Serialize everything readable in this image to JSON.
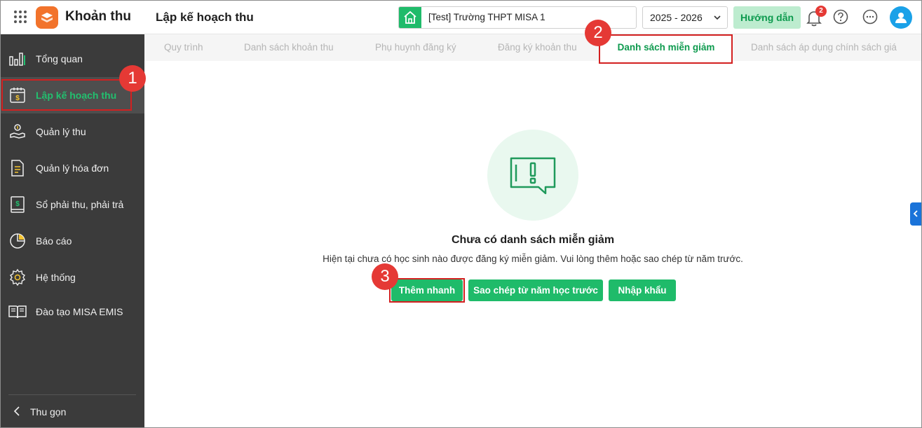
{
  "header": {
    "app_title": "Khoản thu",
    "page_title": "Lập kế hoạch thu",
    "school": "[Test] Trường THPT MISA 1",
    "year": "2025 - 2026",
    "guide_button": "Hướng dẫn",
    "notification_count": "2"
  },
  "sidebar": {
    "items": [
      {
        "label": "Tổng quan",
        "icon": "chart-bar-icon"
      },
      {
        "label": "Lập kế hoạch thu",
        "icon": "calendar-money-icon"
      },
      {
        "label": "Quản lý thu",
        "icon": "hand-coin-icon"
      },
      {
        "label": "Quản lý hóa đơn",
        "icon": "document-icon"
      },
      {
        "label": "Sổ phải thu, phải trả",
        "icon": "ledger-icon"
      },
      {
        "label": "Báo cáo",
        "icon": "pie-chart-icon"
      },
      {
        "label": "Hệ thống",
        "icon": "gear-icon"
      },
      {
        "label": "Đào tạo MISA EMIS",
        "icon": "book-open-icon"
      }
    ],
    "collapse_label": "Thu gọn"
  },
  "tabs": [
    "Quy trình",
    "Danh sách khoản thu",
    "Phụ huynh đăng ký",
    "Đăng ký khoản thu",
    "Danh sách miễn giảm",
    "Danh sách áp dụng chính sách giá"
  ],
  "empty_state": {
    "title": "Chưa có danh sách miễn giảm",
    "description": "Hiện tại chưa có học sinh nào được đăng ký miễn giảm. Vui lòng thêm hoặc sao chép từ năm trước."
  },
  "actions": {
    "quick_add": "Thêm nhanh",
    "copy_prev": "Sao chép từ năm học trước",
    "import": "Nhập khẩu"
  },
  "annotations": [
    "1",
    "2",
    "3"
  ],
  "colors": {
    "accent": "#1fbb6a",
    "sidebar_bg": "#3b3b3b",
    "highlight": "#d32020"
  }
}
